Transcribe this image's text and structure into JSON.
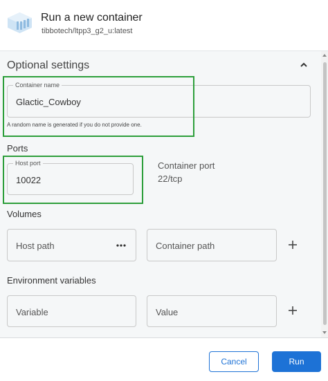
{
  "dialog": {
    "title": "Run a new container",
    "image_name": "tibbotech/ltpp3_g2_u:latest"
  },
  "optional_settings": {
    "title": "Optional settings",
    "collapse_icon": "chevron-up-icon"
  },
  "container_name": {
    "legend": "Container name",
    "value": "Glactic_Cowboy",
    "helper": "A random name is generated if you do not provide one."
  },
  "ports": {
    "title": "Ports",
    "host_port_legend": "Host port",
    "host_port_value": "10022",
    "container_port_label": "Container port",
    "container_port_value": "22/tcp"
  },
  "volumes": {
    "title": "Volumes",
    "host_path_placeholder": "Host path",
    "container_path_placeholder": "Container path",
    "more_icon": "more-horizontal-icon",
    "add_icon": "plus-icon"
  },
  "env": {
    "title": "Environment variables",
    "variable_placeholder": "Variable",
    "value_placeholder": "Value",
    "add_icon": "plus-icon"
  },
  "footer": {
    "cancel_label": "Cancel",
    "run_label": "Run"
  },
  "colors": {
    "accent": "#1d72d6",
    "highlight": "#2c9e3a",
    "content_bg": "#f5f7f8"
  }
}
